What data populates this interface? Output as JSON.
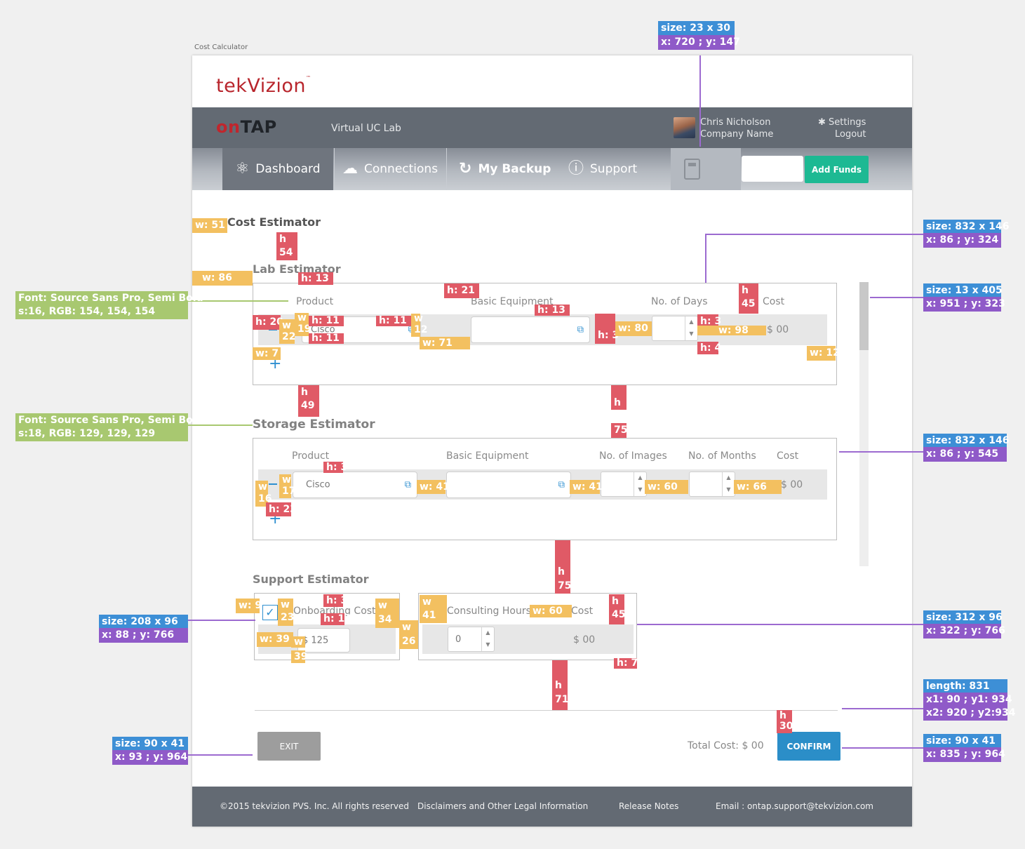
{
  "page_caption": "Cost Calculator",
  "brand": {
    "logo_text": "tekVizion",
    "tm": "™",
    "product_on": "on",
    "product_tap": "TAP",
    "lab_title": "Virtual UC Lab"
  },
  "user": {
    "name": "Chris Nicholson",
    "company": "Company Name",
    "settings_label": "Settings",
    "logout_label": "Logout"
  },
  "nav": {
    "dashboard": "Dashboard",
    "connections": "Connections",
    "backup": "My Backup",
    "support": "Support",
    "add_funds": "Add Funds"
  },
  "cost_estimator": {
    "title": "Cost Estimator"
  },
  "lab": {
    "title": "Lab Estimator",
    "headers": {
      "product": "Product",
      "equipment": "Basic Equipment",
      "days": "No. of Days",
      "cost": "Cost"
    },
    "row": {
      "product": "Cisco",
      "equipment": "",
      "days": "",
      "cost": "$ 00"
    }
  },
  "storage": {
    "title": "Storage Estimator",
    "headers": {
      "product": "Product",
      "equipment": "Basic Equipment",
      "images": "No. of Images",
      "months": "No. of Months",
      "cost": "Cost"
    },
    "row": {
      "product": "Cisco",
      "equipment": "",
      "images": "",
      "months": "",
      "cost": "$ 00"
    }
  },
  "support": {
    "title": "Support Estimator",
    "onboarding_label": "Onboarding Cost",
    "onboarding_value": "$ 125",
    "onboarding_checked": true,
    "consulting_label": "Consulting Hours",
    "consulting_value": "0",
    "consulting_cost_label": "Cost",
    "consulting_cost": "$ 00"
  },
  "actions": {
    "exit": "EXIT",
    "confirm": "CONFIRM",
    "total": "Total Cost: $ 00"
  },
  "footer": {
    "copyright": "©2015  tekvizion PVS. Inc. All rights reserved",
    "disclaimer": "Disclaimers and Other Legal Information",
    "release_notes": "Release Notes",
    "email": "Email : ontap.support@tekvizion.com"
  },
  "annotations": {
    "calc_size": "size: 23 x 30",
    "calc_pos": "x: 720 ; y: 147",
    "lab_size": "size: 832 x 146",
    "lab_pos": "x: 86 ; y: 324",
    "scroll_size": "size: 13 x 405",
    "scroll_pos": "x: 951 ; y: 323",
    "font_product_1": "Font: Source Sans Pro, Semi Bold",
    "font_product_2": "s:16, RGB: 154, 154, 154",
    "font_storage_1": "Font: Source Sans Pro, Semi Bold",
    "font_storage_2": "s:18, RGB: 129, 129, 129",
    "storage_size": "size: 832 x 146",
    "storage_pos": "x: 86 ; y: 545",
    "onboard_size": "size: 208 x 96",
    "onboard_pos": "x: 88 ; y: 766",
    "consult_size": "size: 312 x 96",
    "consult_pos": "x: 322 ; y: 766",
    "line_len": "length: 831",
    "line_p1": "x1: 90 ; y1: 934",
    "line_p2": "x2: 920 ; y2:934",
    "exit_size": "size: 90 x 41",
    "exit_pos": "x: 93 ; y: 964",
    "confirm_size": "size: 90 x 41",
    "confirm_pos": "x: 835 ; y: 964",
    "m_w51": "w: 51",
    "m_h54a": "h",
    "m_h54b": "54",
    "m_w86": "w: 86",
    "m_h13a": "h: 13",
    "m_h21": "h: 21",
    "m_h13b": "h: 13",
    "m_h45a": "h",
    "m_h45b": "45",
    "m_h20": "h: 20",
    "m_w19a": "w",
    "m_w19b": "19",
    "m_w22a": "w",
    "m_w22b": "22",
    "m_h11a": "h: 11",
    "m_h11b": "h: 11",
    "m_h11c": "h: 11",
    "m_w12a": "w",
    "m_w12b": "12",
    "m_w71": "w: 71",
    "m_h3a": "h: 3",
    "m_w80": "w: 80",
    "m_h3b": "h: 3",
    "m_w98": "w: 98",
    "m_h4": "h: 4",
    "m_w7": "w: 7",
    "m_w12c": "w: 12",
    "m_h49a": "h",
    "m_h49b": "49",
    "m_h75a": "h",
    "m_h75b": "75",
    "m_h3c": "h: 3",
    "m_w17a": "w",
    "m_w17b": "17",
    "m_w16a": "w",
    "m_w16b": "16",
    "m_h23": "h: 23",
    "m_w41a": "w: 41",
    "m_w41b": "w: 41",
    "m_w60": "w: 60",
    "m_w66": "w: 66",
    "m_h75c": "h",
    "m_h75d": "75",
    "m_w9": "w: 9",
    "m_w23a": "w",
    "m_w23b": "23",
    "m_h3d": "h: 3",
    "m_h14": "h: 14",
    "m_w34a": "w",
    "m_w34b": "34",
    "m_w41c": "w",
    "m_w41d": "41",
    "m_w60b": "w: 60",
    "m_h45c": "h",
    "m_h45d": "45",
    "m_w39": "w: 39",
    "m_w39b": "w",
    "m_w39c": "39",
    "m_w26a": "w",
    "m_w26b": "26",
    "m_h71": "h: 71",
    "m_h71a": "h",
    "m_h71b": "71",
    "m_h30a": "h",
    "m_h30b": "30"
  }
}
